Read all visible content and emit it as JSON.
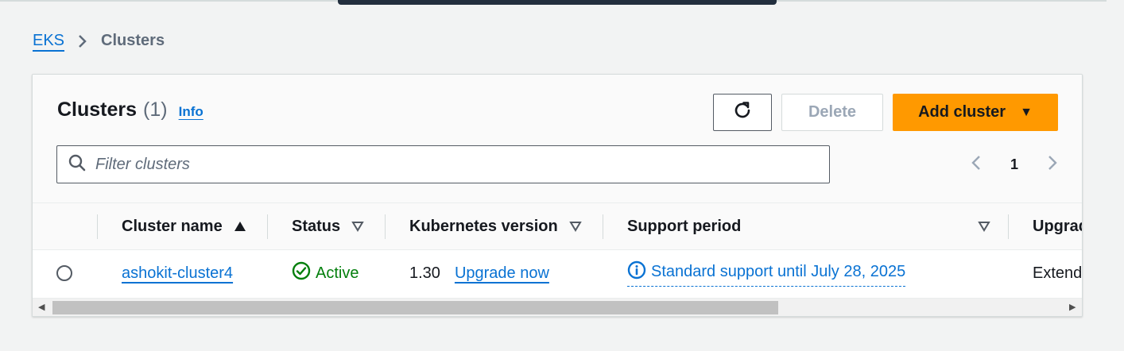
{
  "breadcrumb": {
    "root": "EKS",
    "current": "Clusters"
  },
  "header": {
    "title": "Clusters",
    "count": "(1)",
    "info_label": "Info"
  },
  "actions": {
    "refresh_icon": "refresh-icon",
    "delete_label": "Delete",
    "add_label": "Add cluster"
  },
  "filter": {
    "placeholder": "Filter clusters",
    "value": ""
  },
  "pagination": {
    "current_page": "1"
  },
  "table": {
    "columns": [
      "Cluster name",
      "Status",
      "Kubernetes version",
      "Support period",
      "Upgrade"
    ],
    "rows": [
      {
        "cluster_name": "ashokit-cluster4",
        "status": "Active",
        "version": "1.30",
        "upgrade_link": "Upgrade now",
        "support_period": "Standard support until July 28, 2025",
        "upgrade_policy": "Extended"
      }
    ]
  },
  "colors": {
    "accent": "#0972d3",
    "primary_button": "#ff9900",
    "success": "#037f0c",
    "text": "#16191f",
    "muted": "#5f6b7a"
  }
}
